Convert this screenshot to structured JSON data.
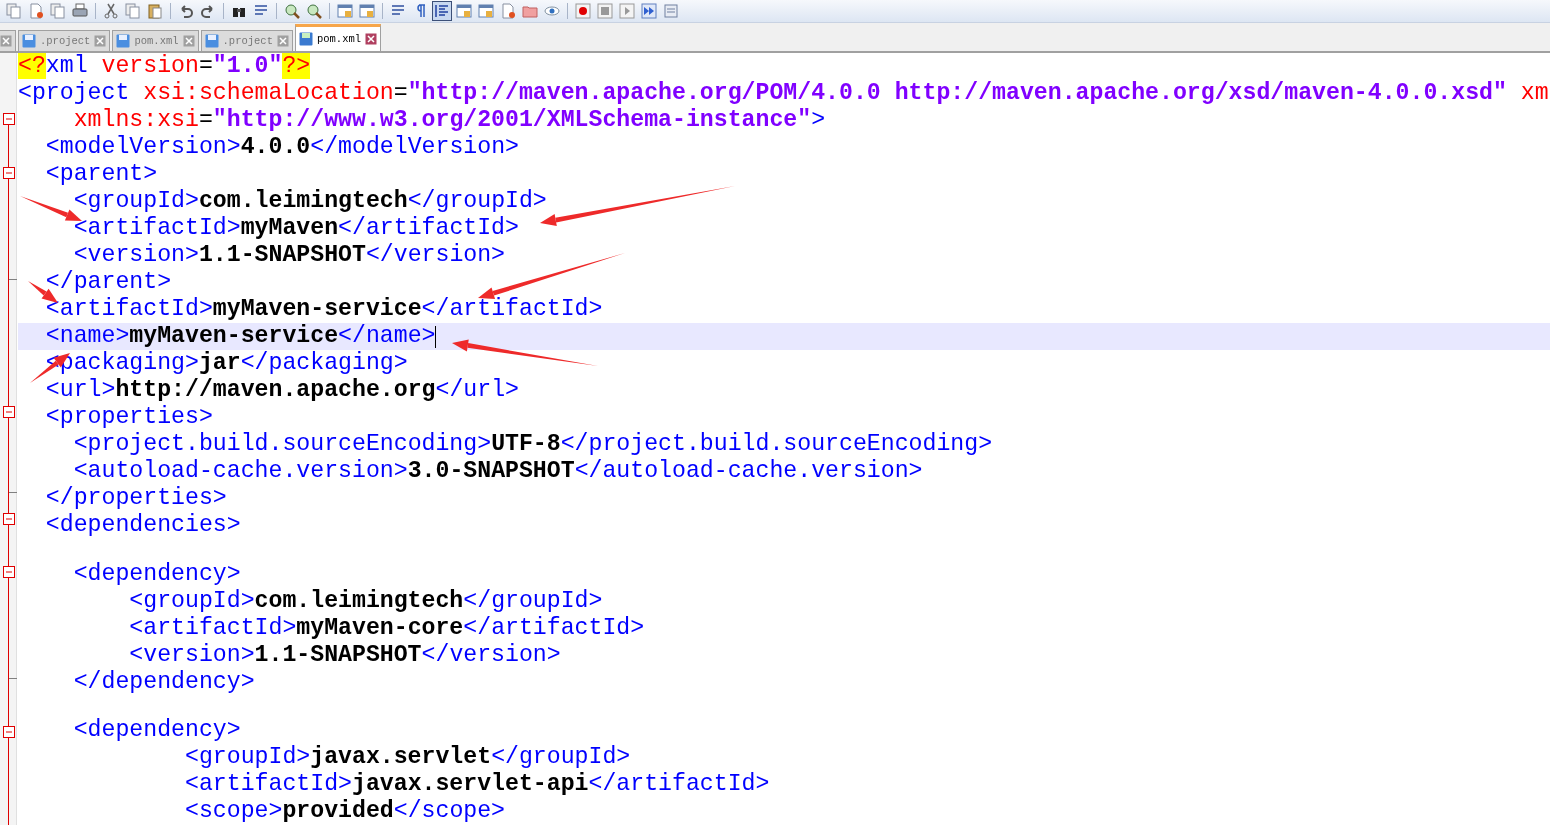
{
  "tabs": [
    {
      "label": ".project",
      "selected": false
    },
    {
      "label": "pom.xml",
      "selected": false
    },
    {
      "label": ".project",
      "selected": false
    },
    {
      "label": "pom.xml",
      "selected": true
    }
  ],
  "editor": {
    "lines": [
      {
        "foldable": false,
        "fold_end": false,
        "current": false,
        "tokens": [
          {
            "kind": "pi",
            "text": "<?"
          },
          {
            "kind": "tag",
            "text": "xml"
          },
          {
            "kind": "attr",
            "text": " version"
          },
          {
            "kind": "op",
            "text": "="
          },
          {
            "kind": "value",
            "text": "\"1.0\""
          },
          {
            "kind": "pi",
            "text": "?>"
          }
        ]
      },
      {
        "foldable": false,
        "fold_end": false,
        "current": false,
        "tokens": [
          {
            "kind": "tag",
            "text": "<project"
          },
          {
            "kind": "attr",
            "text": " xsi:schemaLocation"
          },
          {
            "kind": "op",
            "text": "="
          },
          {
            "kind": "value",
            "text": "\"http://maven.apache.org/POM/4.0.0 http://maven.apache.org/xsd/maven-4.0.0.xsd\""
          },
          {
            "kind": "attr",
            "text": " xm"
          }
        ]
      },
      {
        "foldable": true,
        "fold_end": false,
        "current": false,
        "tokens": [
          {
            "kind": "attr",
            "text": "    xmlns:xsi"
          },
          {
            "kind": "op",
            "text": "="
          },
          {
            "kind": "value",
            "text": "\"http://www.w3.org/2001/XMLSchema-instance\""
          },
          {
            "kind": "tag",
            "text": ">"
          }
        ]
      },
      {
        "foldable": false,
        "fold_end": false,
        "current": false,
        "tokens": [
          {
            "kind": "tag",
            "text": "  <modelVersion>"
          },
          {
            "kind": "text",
            "text": "4.0.0"
          },
          {
            "kind": "tag",
            "text": "</modelVersion>"
          }
        ]
      },
      {
        "foldable": true,
        "fold_end": false,
        "current": false,
        "tokens": [
          {
            "kind": "tag",
            "text": "  <parent>"
          }
        ]
      },
      {
        "foldable": false,
        "fold_end": false,
        "current": false,
        "tokens": [
          {
            "kind": "tag",
            "text": "    <groupId>"
          },
          {
            "kind": "text",
            "text": "com.leimingtech"
          },
          {
            "kind": "tag",
            "text": "</groupId>"
          }
        ]
      },
      {
        "foldable": false,
        "fold_end": false,
        "current": false,
        "tokens": [
          {
            "kind": "tag",
            "text": "    <artifactId>"
          },
          {
            "kind": "text",
            "text": "myMaven"
          },
          {
            "kind": "tag",
            "text": "</artifactId>"
          }
        ]
      },
      {
        "foldable": false,
        "fold_end": false,
        "current": false,
        "tokens": [
          {
            "kind": "tag",
            "text": "    <version>"
          },
          {
            "kind": "text",
            "text": "1.1-SNAPSHOT"
          },
          {
            "kind": "tag",
            "text": "</version>"
          }
        ]
      },
      {
        "foldable": false,
        "fold_end": true,
        "current": false,
        "tokens": [
          {
            "kind": "tag",
            "text": "  </parent>"
          }
        ]
      },
      {
        "foldable": false,
        "fold_end": false,
        "current": false,
        "tokens": [
          {
            "kind": "tag",
            "text": "  <artifactId>"
          },
          {
            "kind": "text",
            "text": "myMaven-service"
          },
          {
            "kind": "tag",
            "text": "</artifactId>"
          }
        ]
      },
      {
        "foldable": false,
        "fold_end": false,
        "current": true,
        "tokens": [
          {
            "kind": "tag",
            "text": "  <name>"
          },
          {
            "kind": "text",
            "text": "myMaven-service"
          },
          {
            "kind": "tag",
            "text": "</name>"
          }
        ]
      },
      {
        "foldable": false,
        "fold_end": false,
        "current": false,
        "tokens": [
          {
            "kind": "tag",
            "text": "  <packaging>"
          },
          {
            "kind": "text",
            "text": "jar"
          },
          {
            "kind": "tag",
            "text": "</packaging>"
          }
        ]
      },
      {
        "foldable": false,
        "fold_end": false,
        "current": false,
        "tokens": [
          {
            "kind": "tag",
            "text": "  <url>"
          },
          {
            "kind": "text",
            "text": "http://maven.apache.org"
          },
          {
            "kind": "tag",
            "text": "</url>"
          }
        ]
      },
      {
        "foldable": true,
        "fold_end": false,
        "current": false,
        "tokens": [
          {
            "kind": "tag",
            "text": "  <properties>"
          }
        ]
      },
      {
        "foldable": false,
        "fold_end": false,
        "current": false,
        "tokens": [
          {
            "kind": "tag",
            "text": "    <project.build.sourceEncoding>"
          },
          {
            "kind": "text",
            "text": "UTF-8"
          },
          {
            "kind": "tag",
            "text": "</project.build.sourceEncoding>"
          }
        ]
      },
      {
        "foldable": false,
        "fold_end": false,
        "current": false,
        "tokens": [
          {
            "kind": "tag",
            "text": "    <autoload-cache.version>"
          },
          {
            "kind": "text",
            "text": "3.0-SNAPSHOT"
          },
          {
            "kind": "tag",
            "text": "</autoload-cache.version>"
          }
        ]
      },
      {
        "foldable": false,
        "fold_end": true,
        "current": false,
        "tokens": [
          {
            "kind": "tag",
            "text": "  </properties>"
          }
        ]
      },
      {
        "foldable": true,
        "fold_end": false,
        "current": false,
        "tokens": [
          {
            "kind": "tag",
            "text": "  <dependencies>"
          }
        ]
      },
      {
        "foldable": false,
        "fold_end": false,
        "current": false
      },
      {
        "foldable": true,
        "fold_end": false,
        "current": false,
        "tokens": [
          {
            "kind": "tag",
            "text": "    <dependency>"
          }
        ]
      },
      {
        "foldable": false,
        "fold_end": false,
        "current": false,
        "tokens": [
          {
            "kind": "tag",
            "text": "        <groupId>"
          },
          {
            "kind": "text",
            "text": "com.leimingtech"
          },
          {
            "kind": "tag",
            "text": "</groupId>"
          }
        ]
      },
      {
        "foldable": false,
        "fold_end": false,
        "current": false,
        "tokens": [
          {
            "kind": "tag",
            "text": "        <artifactId>"
          },
          {
            "kind": "text",
            "text": "myMaven-core"
          },
          {
            "kind": "tag",
            "text": "</artifactId>"
          }
        ]
      },
      {
        "foldable": false,
        "fold_end": false,
        "current": false,
        "tokens": [
          {
            "kind": "tag",
            "text": "        <version>"
          },
          {
            "kind": "text",
            "text": "1.1-SNAPSHOT"
          },
          {
            "kind": "tag",
            "text": "</version>"
          }
        ]
      },
      {
        "foldable": false,
        "fold_end": true,
        "current": false,
        "tokens": [
          {
            "kind": "tag",
            "text": "    </dependency>"
          }
        ]
      },
      {
        "foldable": false,
        "fold_end": false,
        "current": false
      },
      {
        "foldable": true,
        "fold_end": false,
        "current": false,
        "tokens": [
          {
            "kind": "tag",
            "text": "    <dependency>"
          }
        ]
      },
      {
        "foldable": false,
        "fold_end": false,
        "current": false,
        "tokens": [
          {
            "kind": "tag",
            "text": "            <groupId>"
          },
          {
            "kind": "text",
            "text": "javax.servlet"
          },
          {
            "kind": "tag",
            "text": "</groupId>"
          }
        ]
      },
      {
        "foldable": false,
        "fold_end": false,
        "current": false,
        "tokens": [
          {
            "kind": "tag",
            "text": "            <artifactId>"
          },
          {
            "kind": "text",
            "text": "javax.servlet-api"
          },
          {
            "kind": "tag",
            "text": "</artifactId>"
          }
        ]
      },
      {
        "foldable": false,
        "fold_end": false,
        "current": false,
        "tokens": [
          {
            "kind": "tag",
            "text": "            <scope>"
          },
          {
            "kind": "text",
            "text": "provided"
          },
          {
            "kind": "tag",
            "text": "</scope>"
          }
        ]
      }
    ]
  }
}
